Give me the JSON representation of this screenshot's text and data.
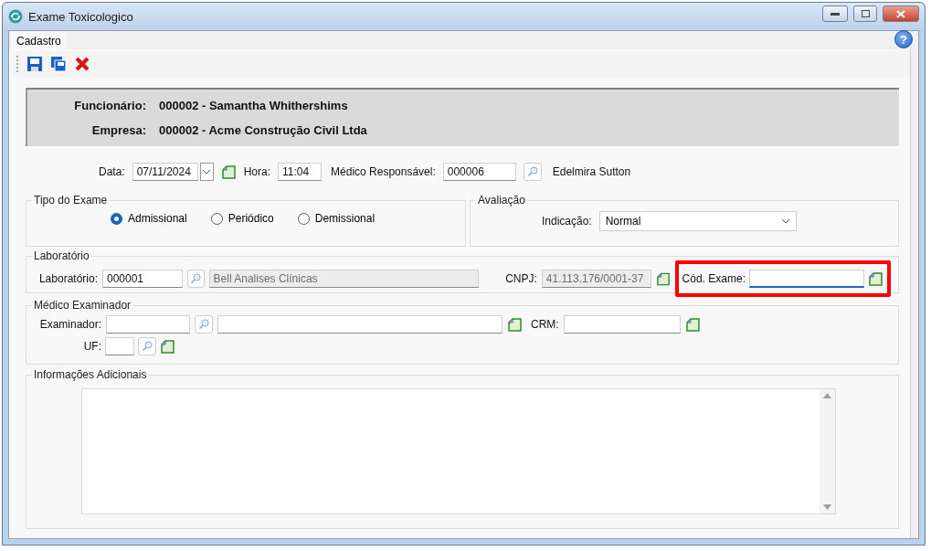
{
  "window": {
    "title": "Exame Toxicologico"
  },
  "tabs": [
    {
      "label": "Cadastro",
      "selected": true
    }
  ],
  "help_button": "?",
  "header": [
    {
      "label": "Funcionário:",
      "value": "000002 - Samantha Whithershims"
    },
    {
      "label": "Empresa:",
      "value": "000002 - Acme Construção Civil Ltda"
    }
  ],
  "exam_info": {
    "date_label": "Data:",
    "date": "07/11/2024",
    "time_label": "Hora:",
    "time": "11:04",
    "doctor_label": "Médico Responsável:",
    "doctor_code": "000006",
    "doctor_name": "Edelmira Sutton"
  },
  "exam_type": {
    "title": "Tipo do Exame",
    "options": [
      {
        "label": "Admissional",
        "selected": true
      },
      {
        "label": "Periódico",
        "selected": false
      },
      {
        "label": "Demissional",
        "selected": false
      }
    ]
  },
  "evaluation": {
    "title": "Avaliação",
    "label": "Indicação:",
    "value": "Normal"
  },
  "laboratory": {
    "title": "Laboratório",
    "label": "Laboratório:",
    "code": "000001",
    "name": "Bell Analises Clínicas",
    "cnpj_label": "CNPJ:",
    "cnpj": "41.113.176/0001-37",
    "exam_code_label": "Cód. Exame:",
    "exam_code_highlighted": true
  },
  "examiner": {
    "title": "Médico Examinador",
    "examiner_label": "Examinador:",
    "crm_label": "CRM:",
    "uf_label": "UF:"
  },
  "notes": {
    "title": "Informações Adicionais"
  }
}
